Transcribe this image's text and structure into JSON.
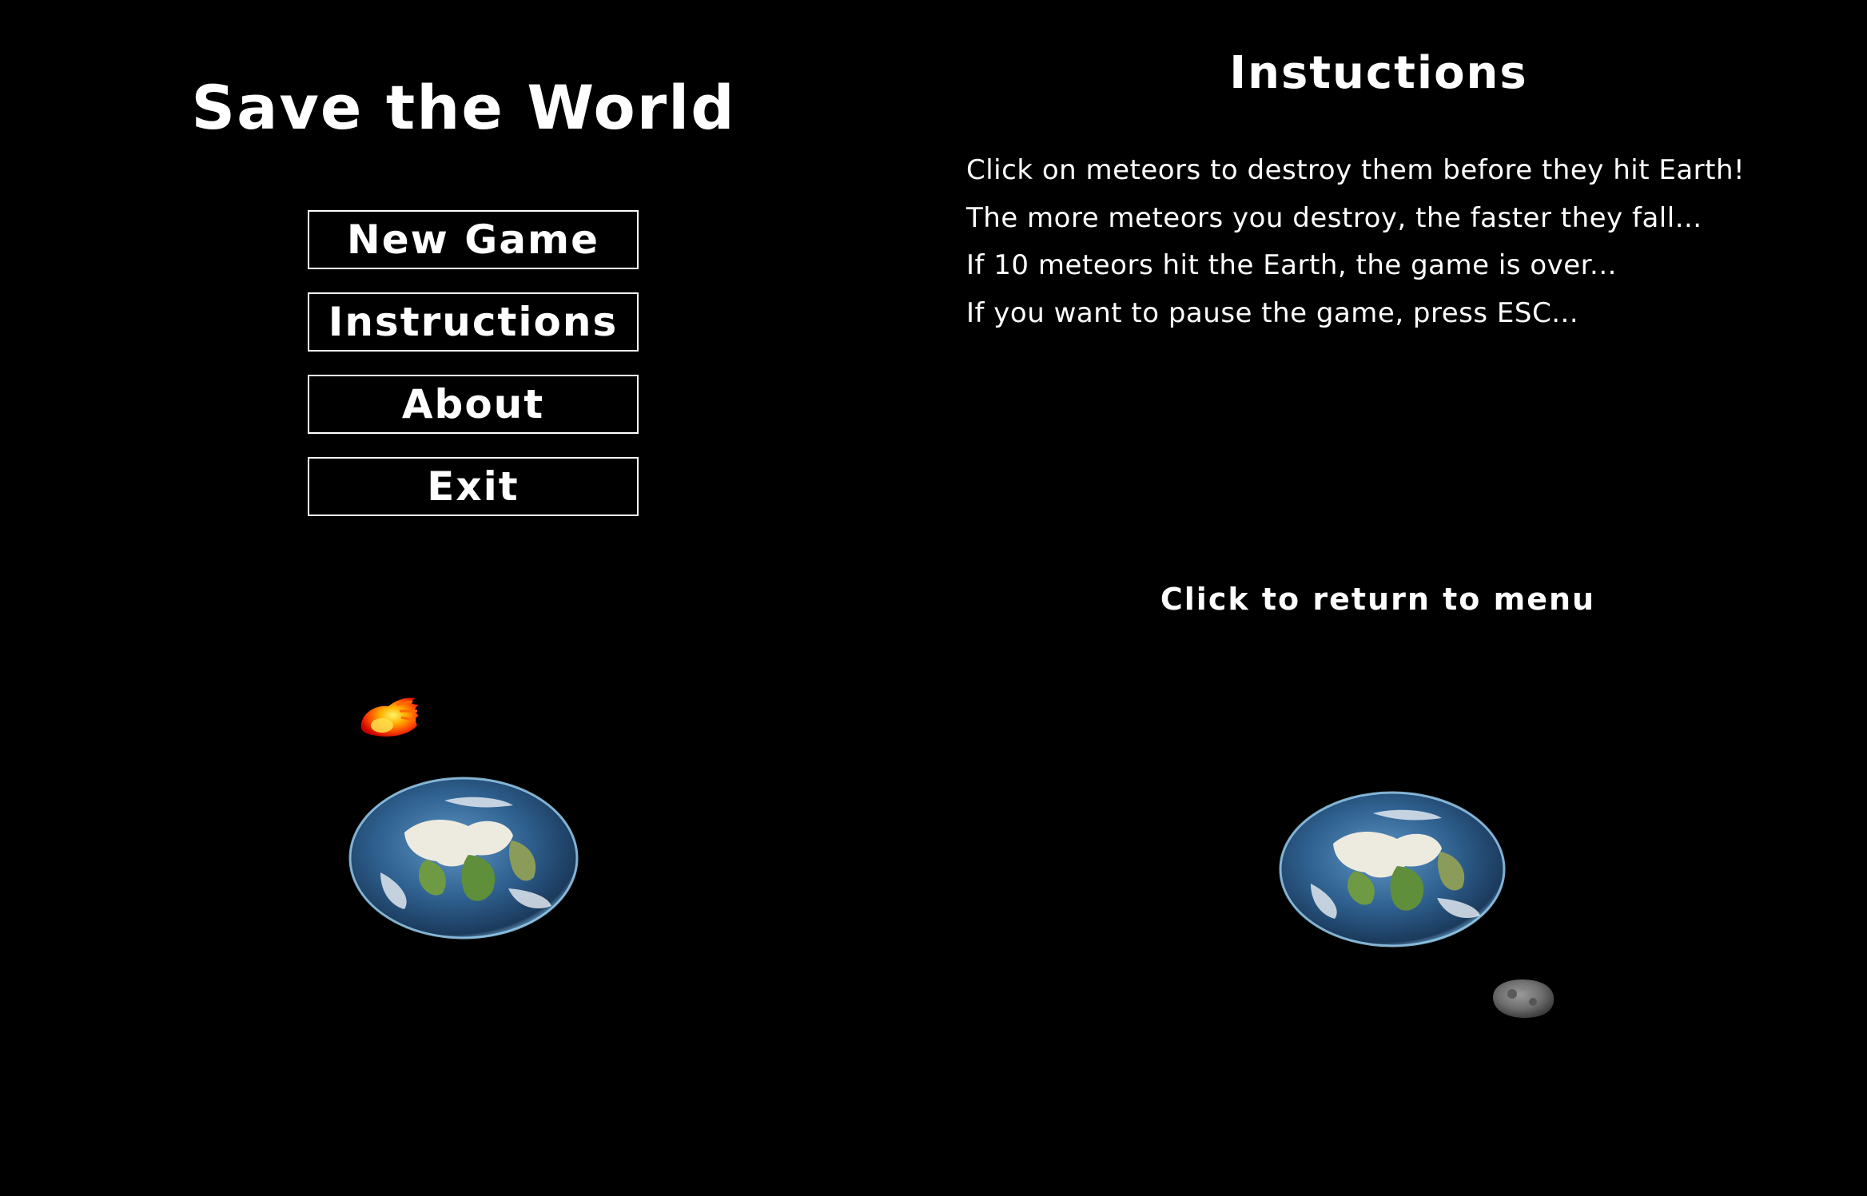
{
  "menu": {
    "title": "Save the World",
    "buttons": {
      "new_game": "New Game",
      "instructions": "Instructions",
      "about": "About",
      "exit": "Exit"
    }
  },
  "instructions_panel": {
    "title": "Instuctions",
    "lines": [
      "Click on meteors to destroy them before they hit Earth!",
      "The more meteors you destroy, the faster they fall...",
      "If 10 meteors hit the Earth, the game is over...",
      "If you want to pause the game, press ESC..."
    ],
    "return_text": "Click to return to menu"
  },
  "sprites": {
    "earth_left": "earth-icon",
    "earth_right": "earth-icon",
    "fire_meteor": "flaming-meteor-icon",
    "rock_meteor": "rock-meteor-icon"
  },
  "colors": {
    "background": "#000000",
    "text": "#ffffff"
  }
}
